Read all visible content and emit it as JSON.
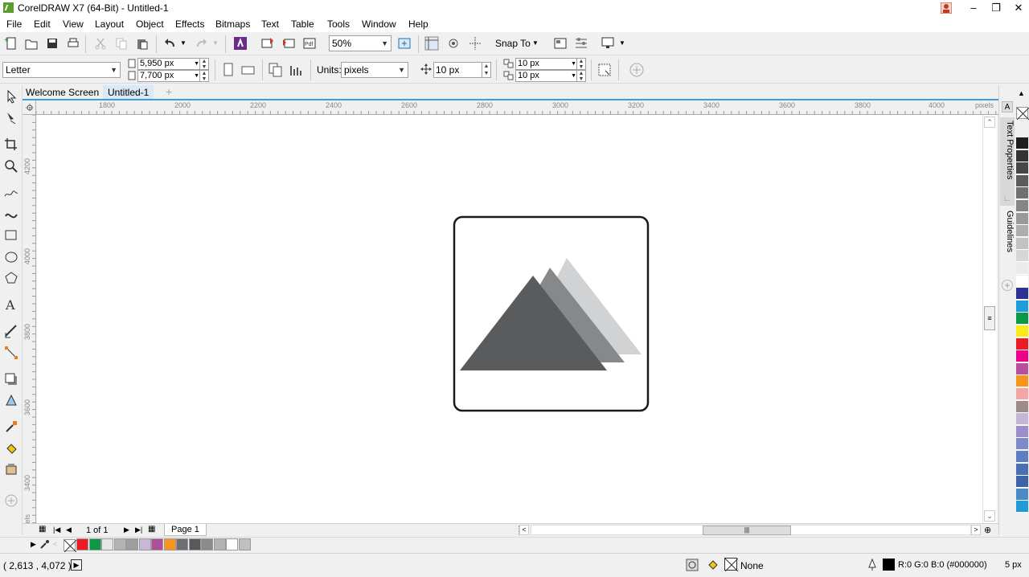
{
  "window": {
    "title": "CorelDRAW X7 (64-Bit) - Untitled-1"
  },
  "menu": [
    "File",
    "Edit",
    "View",
    "Layout",
    "Object",
    "Effects",
    "Bitmaps",
    "Text",
    "Table",
    "Tools",
    "Window",
    "Help"
  ],
  "toolbar": {
    "zoom": "50%",
    "snap_to": "Snap To"
  },
  "propbar": {
    "page_size": "Letter",
    "width": "5,950 px",
    "height": "7,700 px",
    "units_label": "Units:",
    "units": "pixels",
    "nudge": "10 px",
    "dup_x": "10 px",
    "dup_y": "10 px"
  },
  "tabs": {
    "welcome": "Welcome Screen",
    "doc": "Untitled-1"
  },
  "hruler": {
    "ticks": [
      "1800",
      "2000",
      "2200",
      "2400",
      "2600",
      "2800",
      "3000",
      "3200",
      "3400",
      "3600",
      "3800",
      "4000"
    ],
    "unit": "pixels"
  },
  "vruler": {
    "ticks": [
      "4200",
      "4000",
      "3800",
      "3600",
      "3400"
    ],
    "unit": "pixels"
  },
  "dockers": {
    "text_properties": "Text Properties",
    "guidelines": "Guidelines"
  },
  "pagenav": {
    "count": "1 of 1",
    "page": "Page 1"
  },
  "status": {
    "coords": "( 2,613 , 4,072 )",
    "fill": "None",
    "outline": "R:0 G:0 B:0 (#000000)",
    "outline_width": "5 px"
  },
  "artwork": {
    "frame_color": "#1a1a1a",
    "triangle_colors": [
      "#5a5b5d",
      "#87888a",
      "#d1d2d3"
    ]
  },
  "colors": {
    "right_palette": [
      "#ffffff",
      "#1f1f1f",
      "#333333",
      "#474747",
      "#5c5c5c",
      "#707070",
      "#858585",
      "#999999",
      "#adadad",
      "#c2c2c2",
      "#d6d6d6",
      "#ebebeb",
      "#ffffff",
      "#2d3192",
      "#1a9fdb",
      "#0a9a47",
      "#f7ec13",
      "#ed1c24",
      "#ec008c",
      "#b94f9d",
      "#f7941d",
      "#f4a6a6",
      "#9c8b89",
      "#c3b7d6",
      "#9c8ec9",
      "#7d8ac9",
      "#5e7ec4",
      "#4a6fb6",
      "#3c65a8",
      "#4b8ac3",
      "#1f9bd7"
    ],
    "doc_palette": [
      "#ed1c24",
      "#0a9a47",
      "#e6e6e6",
      "#b3b3b3",
      "#9e9e9e",
      "#c8b8d8",
      "#b04e9c",
      "#f7941d",
      "#6d6e71",
      "#58595b",
      "#8a8a8a",
      "#b3b3b3",
      "#ffffff",
      "#c0c0c0"
    ]
  }
}
